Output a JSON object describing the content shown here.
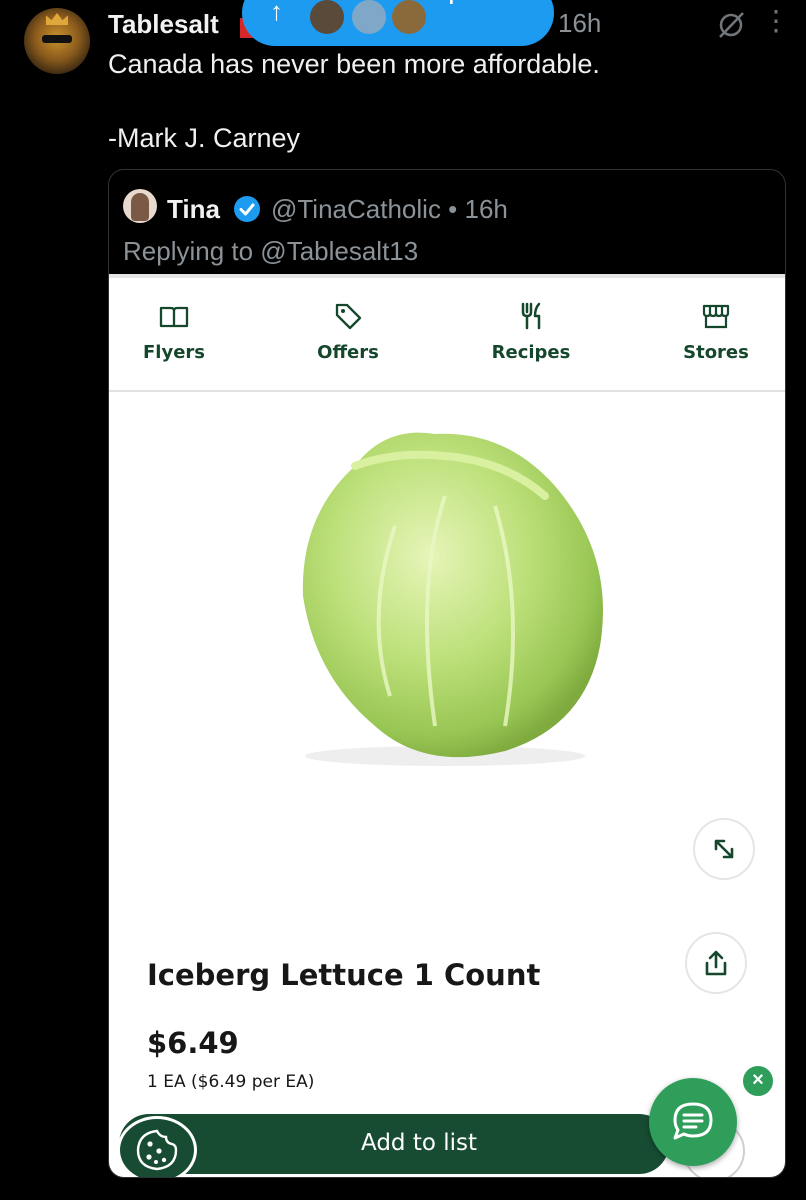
{
  "tweet": {
    "author": "Tablesalt",
    "time": "16h",
    "text": "Canada has never been more affordable.\n\n-Mark J. Carney",
    "banner_label": "posted"
  },
  "quote": {
    "name": "Tina",
    "handle_time": "@TinaCatholic • 16h",
    "replying_to": "Replying to @Tablesalt13"
  },
  "store_app": {
    "nav": [
      "Flyers",
      "Offers",
      "Recipes",
      "Stores"
    ],
    "product_title": "Iceberg Lettuce 1 Count",
    "price": "$6.49",
    "unit_price": "1 EA ($6.49 per EA)",
    "add_label": "Add to list"
  },
  "colors": {
    "brand_green": "#174c33",
    "chat_green": "#2f9e5b",
    "link_blue": "#1d9bf0"
  },
  "icons": [
    "mute-icon",
    "more-icon",
    "verified-icon",
    "book-icon",
    "tag-icon",
    "fork-knife-icon",
    "store-icon",
    "expand-icon",
    "share-icon",
    "cookie-icon",
    "chat-icon",
    "close-icon"
  ]
}
